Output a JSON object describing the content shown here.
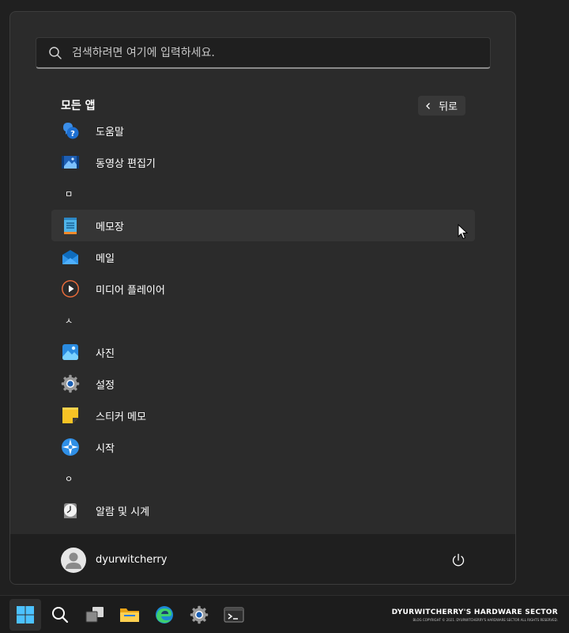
{
  "search": {
    "placeholder": "검색하려면 여기에 입력하세요."
  },
  "all_apps": {
    "title": "모든 앱",
    "back_label": "뒤로"
  },
  "apps": [
    {
      "type": "app",
      "label": "도움말",
      "icon": "help-icon"
    },
    {
      "type": "app",
      "label": "동영상 편집기",
      "icon": "video-editor-icon"
    },
    {
      "type": "letter",
      "label": "ㅁ"
    },
    {
      "type": "app",
      "label": "메모장",
      "icon": "notepad-icon",
      "hovered": true
    },
    {
      "type": "app",
      "label": "메일",
      "icon": "mail-icon"
    },
    {
      "type": "app",
      "label": "미디어 플레이어",
      "icon": "media-player-icon"
    },
    {
      "type": "letter",
      "label": "ㅅ"
    },
    {
      "type": "app",
      "label": "사진",
      "icon": "photos-icon"
    },
    {
      "type": "app",
      "label": "설정",
      "icon": "settings-icon"
    },
    {
      "type": "app",
      "label": "스티커 메모",
      "icon": "sticky-notes-icon"
    },
    {
      "type": "app",
      "label": "시작",
      "icon": "get-started-icon"
    },
    {
      "type": "letter",
      "label": "ㅇ"
    },
    {
      "type": "app",
      "label": "알람 및 시계",
      "icon": "alarms-clock-icon"
    }
  ],
  "user": {
    "name": "dyurwitcherry"
  },
  "taskbar": {
    "items": [
      "start-icon",
      "search-icon",
      "task-view-icon",
      "file-explorer-icon",
      "edge-icon",
      "settings-icon",
      "terminal-icon"
    ]
  },
  "watermark": {
    "title": "DYURWITCHERRY'S HARDWARE SECTOR",
    "subtitle": "BLOG COPYRIGHT © 2021. DYURWITCHERRY'S HARDWARE SECTOR ALL RIGHTS RESERVED."
  },
  "colors": {
    "accent": "#4cc2ff",
    "panel": "#2b2b2b",
    "taskbar": "#1c1c1c"
  }
}
